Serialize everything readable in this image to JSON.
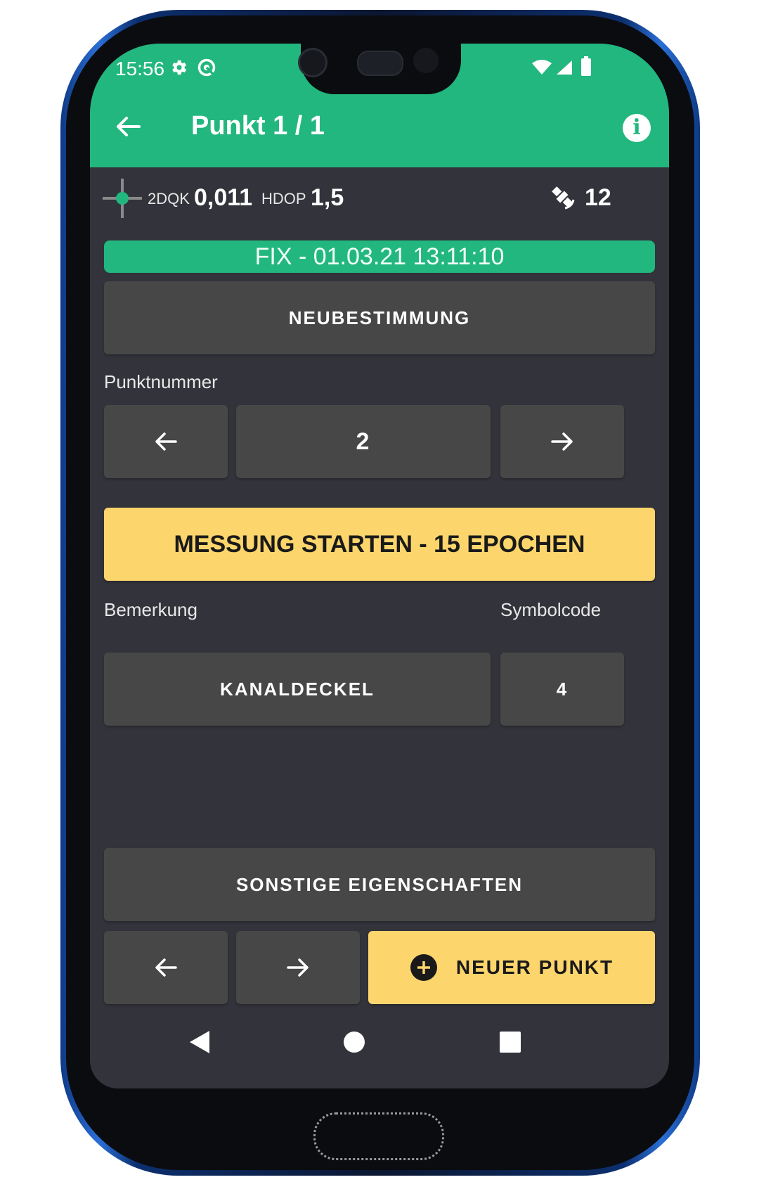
{
  "status": {
    "time": "15:56",
    "icons": [
      "gear-icon",
      "sync-icon",
      "wifi-icon",
      "signal-icon",
      "battery-icon"
    ]
  },
  "appbar": {
    "title": "Punkt 1 / 1",
    "back_icon": "arrow-left-icon",
    "info_icon": "info-icon"
  },
  "gps": {
    "quality_label": "2DQK",
    "quality_value": "0,011",
    "hdop_label": "HDOP",
    "hdop_value": "1,5",
    "satellites": "12"
  },
  "fix": {
    "text": "FIX - 01.03.21 13:11:10"
  },
  "redetermine_button": "NEUBESTIMMUNG",
  "point_number": {
    "label": "Punktnummer",
    "value": "2"
  },
  "measure_button": "MESSUNG STARTEN - 15 EPOCHEN",
  "remark": {
    "label": "Bemerkung",
    "value": "KANALDECKEL"
  },
  "symbolcode": {
    "label": "Symbolcode",
    "value": "4"
  },
  "other_properties_button": "SONSTIGE EIGENSCHAFTEN",
  "new_point_button": "NEUER PUNKT",
  "colors": {
    "accent_green": "#22b77f",
    "accent_yellow": "#fcd56c",
    "background": "#33333b",
    "button_gray": "#474747"
  }
}
